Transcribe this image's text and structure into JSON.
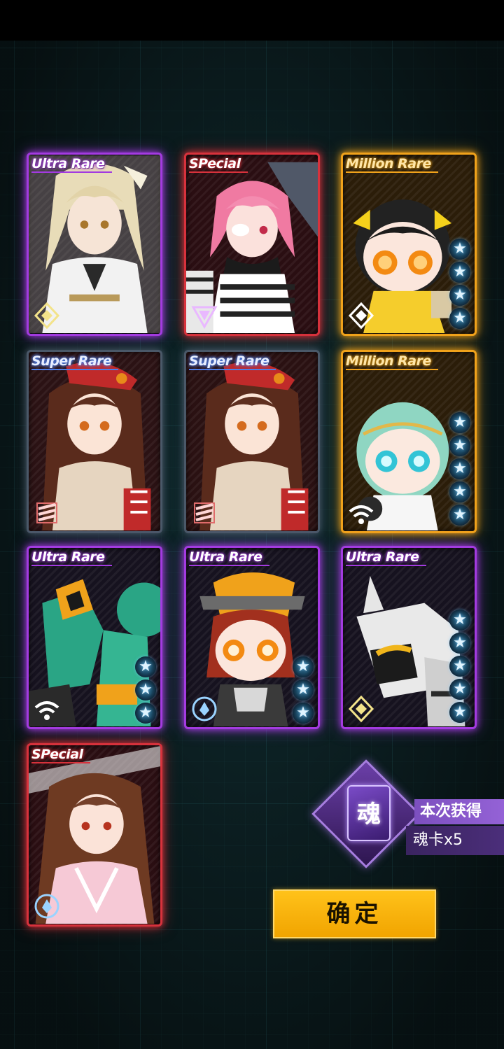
{
  "cards": [
    {
      "rarity": "Ultra Rare",
      "tier": "ur",
      "stars": 0,
      "class_icon": "diamond-class-icon",
      "art": "blonde-girl-white-uniform"
    },
    {
      "rarity": "SPecial",
      "tier": "sp",
      "stars": 0,
      "class_icon": "triangle-class-icon",
      "art": "pink-hair-girl-eyepatch"
    },
    {
      "rarity": "Million Rare",
      "tier": "mr",
      "stars": 4,
      "class_icon": "diamond-class-icon",
      "art": "chibi-black-hair-yellow-dress"
    },
    {
      "rarity": "Super Rare",
      "tier": "sr",
      "stars": 0,
      "class_icon": "stripes-class-icon",
      "art": "brown-hair-girl-red-beret"
    },
    {
      "rarity": "Super Rare",
      "tier": "sr2",
      "stars": 0,
      "class_icon": "stripes-class-icon",
      "art": "brown-hair-girl-red-beret"
    },
    {
      "rarity": "Million Rare",
      "tier": "mr",
      "stars": 5,
      "class_icon": "signal-class-icon",
      "art": "chibi-mint-hair-girl"
    },
    {
      "rarity": "Ultra Rare",
      "tier": "ur",
      "stars": 3,
      "class_icon": "signal-class-icon",
      "art": "green-mech-robot"
    },
    {
      "rarity": "Ultra Rare",
      "tier": "ur",
      "stars": 3,
      "class_icon": "circle-class-icon",
      "art": "chibi-red-hair-orange-helmet"
    },
    {
      "rarity": "Ultra Rare",
      "tier": "ur",
      "stars": 5,
      "class_icon": "diamond-class-icon",
      "art": "white-yellow-mech"
    },
    {
      "rarity": "SPecial",
      "tier": "sp",
      "stars": 0,
      "class_icon": "circle-class-icon",
      "art": "brown-hair-girl-pink-kimono"
    }
  ],
  "reward": {
    "card_glyph": "魂",
    "title": "本次获得",
    "count": "魂卡x5"
  },
  "confirm_label": "确定",
  "colors": {
    "ultra_rare": "#a33be0",
    "special": "#d7323c",
    "million_rare": "#f0a21b",
    "super_rare": "#4f7ee8",
    "confirm": "#f5b10a"
  }
}
